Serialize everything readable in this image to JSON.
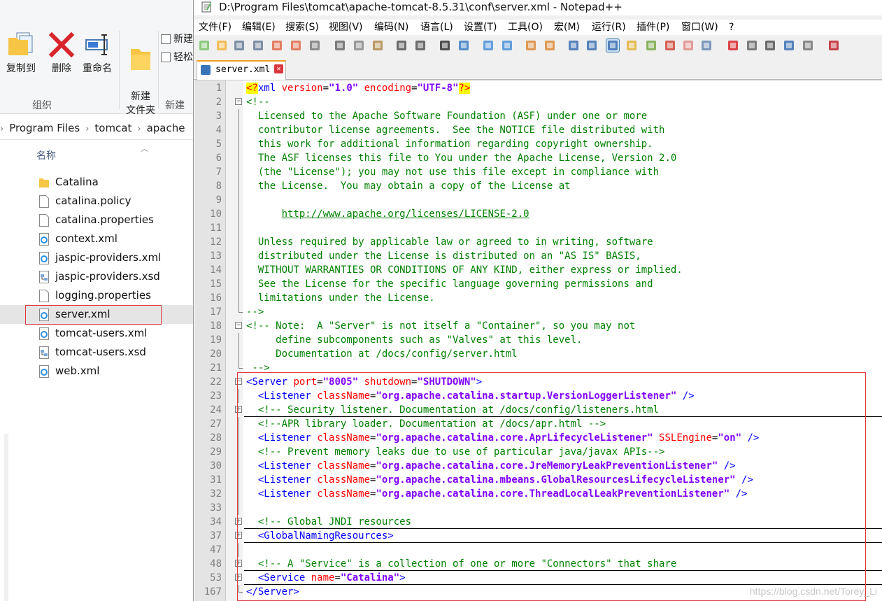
{
  "explorer": {
    "ribbon": {
      "buttons": [
        {
          "label": "复制到",
          "icon": "copy-to-icon"
        },
        {
          "label": "删除",
          "icon": "delete-x-icon"
        },
        {
          "label": "重命名",
          "icon": "rename-icon"
        },
        {
          "label": "新建\n文件夹",
          "icon": "new-folder-icon"
        },
        {
          "label": "新建",
          "icon": "new-item-icon"
        },
        {
          "label": "轻松",
          "icon": "easy-access-icon"
        }
      ],
      "group_labels": [
        "组织",
        "新建"
      ]
    },
    "breadcrumb": [
      "Program Files",
      "tomcat",
      "apache"
    ],
    "column_header": "名称",
    "files": [
      {
        "name": "Catalina",
        "type": "folder"
      },
      {
        "name": "catalina.policy",
        "type": "file"
      },
      {
        "name": "catalina.properties",
        "type": "file"
      },
      {
        "name": "context.xml",
        "type": "xml"
      },
      {
        "name": "jaspic-providers.xml",
        "type": "xml"
      },
      {
        "name": "jaspic-providers.xsd",
        "type": "xsd"
      },
      {
        "name": "logging.properties",
        "type": "file"
      },
      {
        "name": "server.xml",
        "type": "xml",
        "selected": true
      },
      {
        "name": "tomcat-users.xml",
        "type": "xml"
      },
      {
        "name": "tomcat-users.xsd",
        "type": "xsd"
      },
      {
        "name": "web.xml",
        "type": "xml"
      }
    ]
  },
  "notepad": {
    "title": "D:\\Program Files\\tomcat\\apache-tomcat-8.5.31\\conf\\server.xml - Notepad++",
    "menu": [
      "文件(F)",
      "编辑(E)",
      "搜索(S)",
      "视图(V)",
      "编码(N)",
      "语言(L)",
      "设置(T)",
      "工具(O)",
      "宏(M)",
      "运行(R)",
      "插件(P)",
      "窗口(W)",
      "?"
    ],
    "tab_label": "server.xml",
    "watermark": "https://blog.csdn.net/Torey_Li",
    "lines": [
      {
        "n": "1",
        "fold": "",
        "parts": [
          [
            "pi",
            "<?"
          ],
          [
            "tag",
            "xml "
          ],
          [
            "attr",
            "version"
          ],
          [
            "text",
            "="
          ],
          [
            "str",
            "\"1.0\""
          ],
          [
            "text",
            " "
          ],
          [
            "attr",
            "encoding"
          ],
          [
            "text",
            "="
          ],
          [
            "str",
            "\"UTF-8\""
          ],
          [
            "pi",
            "?>"
          ]
        ]
      },
      {
        "n": "2",
        "fold": "minus",
        "parts": [
          [
            "com",
            "<!--"
          ]
        ]
      },
      {
        "n": "3",
        "fold": "line",
        "parts": [
          [
            "com",
            "  Licensed to the Apache Software Foundation (ASF) under one or more"
          ]
        ]
      },
      {
        "n": "4",
        "fold": "line",
        "parts": [
          [
            "com",
            "  contributor license agreements.  See the NOTICE file distributed with"
          ]
        ]
      },
      {
        "n": "5",
        "fold": "line",
        "parts": [
          [
            "com",
            "  this work for additional information regarding copyright ownership."
          ]
        ]
      },
      {
        "n": "6",
        "fold": "line",
        "parts": [
          [
            "com",
            "  The ASF licenses this file to You under the Apache License, Version 2.0"
          ]
        ]
      },
      {
        "n": "7",
        "fold": "line",
        "parts": [
          [
            "com",
            "  (the \"License\"); you may not use this file except in compliance with"
          ]
        ]
      },
      {
        "n": "8",
        "fold": "line",
        "parts": [
          [
            "com",
            "  the License.  You may obtain a copy of the License at"
          ]
        ]
      },
      {
        "n": "9",
        "fold": "line",
        "parts": [
          [
            "com",
            ""
          ]
        ]
      },
      {
        "n": "10",
        "fold": "line",
        "parts": [
          [
            "com",
            "      "
          ],
          [
            "url",
            "http://www.apache.org/licenses/LICENSE-2.0"
          ]
        ]
      },
      {
        "n": "11",
        "fold": "line",
        "parts": [
          [
            "com",
            ""
          ]
        ]
      },
      {
        "n": "12",
        "fold": "line",
        "parts": [
          [
            "com",
            "  Unless required by applicable law or agreed to in writing, software"
          ]
        ]
      },
      {
        "n": "13",
        "fold": "line",
        "parts": [
          [
            "com",
            "  distributed under the License is distributed on an \"AS IS\" BASIS,"
          ]
        ]
      },
      {
        "n": "14",
        "fold": "line",
        "parts": [
          [
            "com",
            "  WITHOUT WARRANTIES OR CONDITIONS OF ANY KIND, either express or implied."
          ]
        ]
      },
      {
        "n": "15",
        "fold": "line",
        "parts": [
          [
            "com",
            "  See the License for the specific language governing permissions and"
          ]
        ]
      },
      {
        "n": "16",
        "fold": "line",
        "parts": [
          [
            "com",
            "  limitations under the License."
          ]
        ]
      },
      {
        "n": "17",
        "fold": "end",
        "parts": [
          [
            "com",
            "-->"
          ]
        ]
      },
      {
        "n": "18",
        "fold": "minus",
        "parts": [
          [
            "com",
            "<!-- Note:  A \"Server\" is not itself a \"Container\", so you may not"
          ]
        ]
      },
      {
        "n": "19",
        "fold": "line",
        "parts": [
          [
            "com",
            "     define subcomponents such as \"Valves\" at this level."
          ]
        ]
      },
      {
        "n": "20",
        "fold": "line",
        "parts": [
          [
            "com",
            "     Documentation at /docs/config/server.html"
          ]
        ]
      },
      {
        "n": "21",
        "fold": "end",
        "parts": [
          [
            "com",
            " -->"
          ]
        ]
      },
      {
        "n": "22",
        "fold": "minus",
        "parts": [
          [
            "tag",
            "<Server "
          ],
          [
            "attr",
            "port"
          ],
          [
            "text",
            "="
          ],
          [
            "str",
            "\"8005\""
          ],
          [
            "text",
            " "
          ],
          [
            "attr",
            "shutdown"
          ],
          [
            "text",
            "="
          ],
          [
            "str",
            "\"SHUTDOWN\""
          ],
          [
            "tag",
            ">"
          ]
        ]
      },
      {
        "n": "23",
        "fold": "line",
        "parts": [
          [
            "text",
            "  "
          ],
          [
            "tag",
            "<Listener "
          ],
          [
            "attr",
            "className"
          ],
          [
            "text",
            "="
          ],
          [
            "str",
            "\"org.apache.catalina.startup.VersionLoggerListener\""
          ],
          [
            "text",
            " "
          ],
          [
            "tag",
            "/>"
          ]
        ]
      },
      {
        "n": "24",
        "fold": "plus",
        "rule": true,
        "parts": [
          [
            "text",
            "  "
          ],
          [
            "com",
            "<!-- Security listener. Documentation at /docs/config/listeners.html"
          ]
        ]
      },
      {
        "n": "27",
        "fold": "line",
        "parts": [
          [
            "text",
            "  "
          ],
          [
            "com",
            "<!--APR library loader. Documentation at /docs/apr.html -->"
          ]
        ]
      },
      {
        "n": "28",
        "fold": "line",
        "parts": [
          [
            "text",
            "  "
          ],
          [
            "tag",
            "<Listener "
          ],
          [
            "attr",
            "className"
          ],
          [
            "text",
            "="
          ],
          [
            "str",
            "\"org.apache.catalina.core.AprLifecycleListener\""
          ],
          [
            "text",
            " "
          ],
          [
            "attr",
            "SSLEngine"
          ],
          [
            "text",
            "="
          ],
          [
            "str",
            "\"on\""
          ],
          [
            "text",
            " "
          ],
          [
            "tag",
            "/>"
          ]
        ]
      },
      {
        "n": "29",
        "fold": "line",
        "parts": [
          [
            "text",
            "  "
          ],
          [
            "com",
            "<!-- Prevent memory leaks due to use of particular java/javax APIs-->"
          ]
        ]
      },
      {
        "n": "30",
        "fold": "line",
        "parts": [
          [
            "text",
            "  "
          ],
          [
            "tag",
            "<Listener "
          ],
          [
            "attr",
            "className"
          ],
          [
            "text",
            "="
          ],
          [
            "str",
            "\"org.apache.catalina.core.JreMemoryLeakPreventionListener\""
          ],
          [
            "text",
            " "
          ],
          [
            "tag",
            "/>"
          ]
        ]
      },
      {
        "n": "31",
        "fold": "line",
        "parts": [
          [
            "text",
            "  "
          ],
          [
            "tag",
            "<Listener "
          ],
          [
            "attr",
            "className"
          ],
          [
            "text",
            "="
          ],
          [
            "str",
            "\"org.apache.catalina.mbeans.GlobalResourcesLifecycleListener\""
          ],
          [
            "text",
            " "
          ],
          [
            "tag",
            "/>"
          ]
        ]
      },
      {
        "n": "32",
        "fold": "line",
        "parts": [
          [
            "text",
            "  "
          ],
          [
            "tag",
            "<Listener "
          ],
          [
            "attr",
            "className"
          ],
          [
            "text",
            "="
          ],
          [
            "str",
            "\"org.apache.catalina.core.ThreadLocalLeakPreventionListener\""
          ],
          [
            "text",
            " "
          ],
          [
            "tag",
            "/>"
          ]
        ]
      },
      {
        "n": "33",
        "fold": "line",
        "parts": [
          [
            "text",
            ""
          ]
        ]
      },
      {
        "n": "34",
        "fold": "plus",
        "rule": true,
        "parts": [
          [
            "text",
            "  "
          ],
          [
            "com",
            "<!-- Global JNDI resources"
          ]
        ]
      },
      {
        "n": "37",
        "fold": "plus",
        "rule": true,
        "parts": [
          [
            "text",
            "  "
          ],
          [
            "tag",
            "<GlobalNamingResources>"
          ]
        ]
      },
      {
        "n": "47",
        "fold": "line",
        "parts": [
          [
            "text",
            ""
          ]
        ]
      },
      {
        "n": "48",
        "fold": "plus",
        "rule": true,
        "parts": [
          [
            "text",
            "  "
          ],
          [
            "com",
            "<!-- A \"Service\" is a collection of one or more \"Connectors\" that share"
          ]
        ]
      },
      {
        "n": "53",
        "fold": "plus",
        "rule": true,
        "parts": [
          [
            "text",
            "  "
          ],
          [
            "tag",
            "<Service "
          ],
          [
            "attr",
            "name"
          ],
          [
            "text",
            "="
          ],
          [
            "str",
            "\"Catalina\""
          ],
          [
            "tag",
            ">"
          ]
        ]
      },
      {
        "n": "167",
        "fold": "end",
        "parts": [
          [
            "tag",
            "</Server>"
          ]
        ]
      }
    ]
  }
}
